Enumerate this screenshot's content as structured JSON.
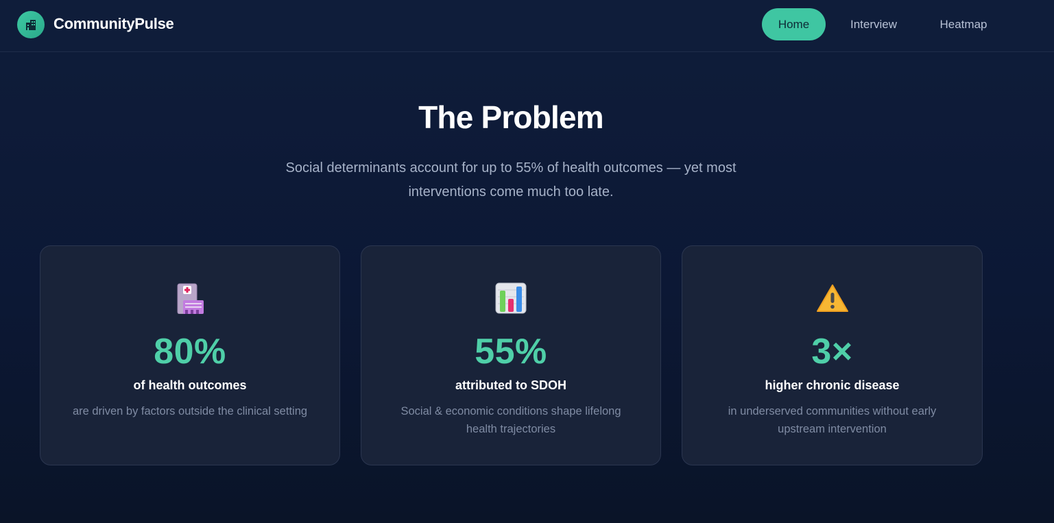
{
  "header": {
    "brand": "CommunityPulse",
    "logo_icon": "building-icon",
    "nav": [
      {
        "label": "Home",
        "active": true
      },
      {
        "label": "Interview",
        "active": false
      },
      {
        "label": "Heatmap",
        "active": false
      }
    ]
  },
  "problem": {
    "title": "The Problem",
    "subtitle": "Social determinants account for up to 55% of health outcomes — yet most interventions come much too late."
  },
  "cards": [
    {
      "icon": "hospital-icon",
      "stat": "80%",
      "heading": "of health outcomes",
      "description": "are driven by factors outside the clinical setting"
    },
    {
      "icon": "bar-chart-icon",
      "stat": "55%",
      "heading": "attributed to SDOH",
      "description": "Social & economic conditions shape lifelong health trajectories"
    },
    {
      "icon": "warning-icon",
      "stat": "3×",
      "heading": "higher chronic disease",
      "description": "in underserved communities without early upstream intervention"
    }
  ],
  "colors": {
    "accent": "#3fc6a2",
    "stat": "#4fcfa8",
    "background": "#0f1d3a",
    "card": "#192339"
  }
}
